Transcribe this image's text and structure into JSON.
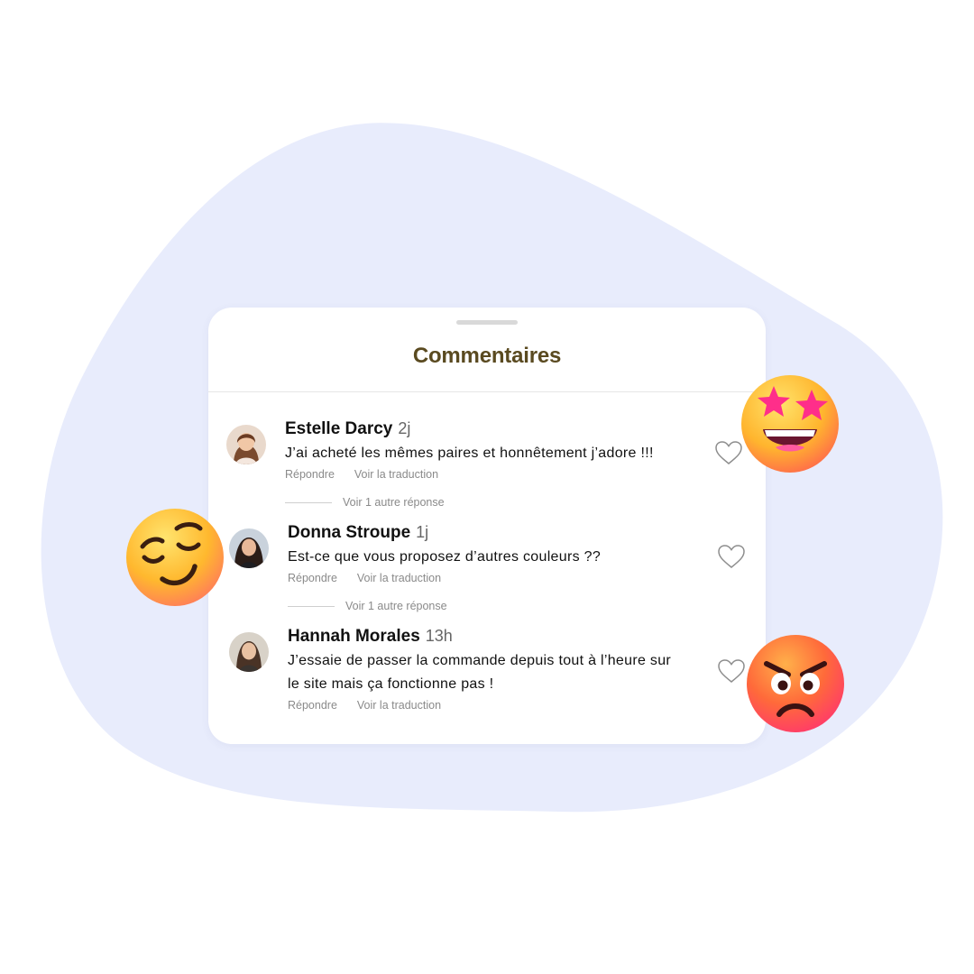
{
  "panel": {
    "title": "Commentaires"
  },
  "comments": [
    {
      "name": "Estelle Darcy",
      "time": "2j",
      "text": "J’ai acheté les mêmes paires et honnêtement j’adore !!!",
      "reply": "Répondre",
      "translate": "Voir la traduction",
      "more_replies": "Voir 1 autre réponse",
      "avatar_icon": "avatar-woman-light-hair"
    },
    {
      "name": "Donna Stroupe",
      "time": "1j",
      "text": "Est-ce que vous proposez d’autres couleurs ??",
      "reply": "Répondre",
      "translate": "Voir la traduction",
      "more_replies": "Voir 1 autre réponse",
      "avatar_icon": "avatar-woman-dark-hair"
    },
    {
      "name": "Hannah Morales",
      "time": "13h",
      "text": "J’essaie de passer la commande depuis tout à l’heure sur le site mais ça fonctionne pas !",
      "reply": "Répondre",
      "translate": "Voir la traduction",
      "avatar_icon": "avatar-woman-brown-hair"
    }
  ],
  "colors": {
    "background_blob": "#e8ecfc",
    "title": "#5a4a20",
    "secondary_text": "#8a8a8a"
  },
  "decorations": {
    "emojis": [
      "star-struck-emoji",
      "relieved-emoji",
      "angry-emoji"
    ]
  }
}
